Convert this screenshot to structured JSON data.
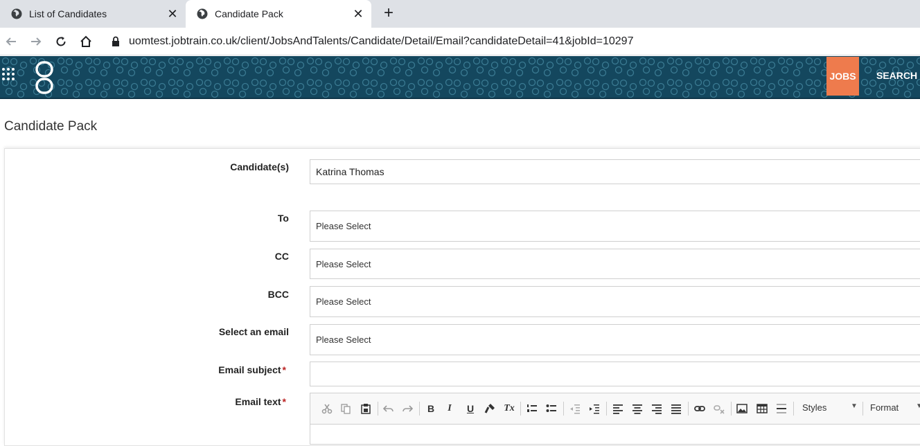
{
  "browser": {
    "tabs": [
      {
        "title": "List of Candidates"
      },
      {
        "title": "Candidate Pack"
      }
    ],
    "close_glyph": "✕",
    "new_tab_glyph": "+",
    "url": "uomtest.jobtrain.co.uk/client/JobsAndTalents/Candidate/Detail/Email?candidateDetail=41&jobId=10297"
  },
  "header": {
    "jobs_label": "JOBS",
    "search_label": "SEARCH",
    "accent_color": "#ee7b4d",
    "header_color": "#14475e"
  },
  "page": {
    "title": "Candidate Pack"
  },
  "form": {
    "candidates_label": "Candidate(s)",
    "candidates_value": "Katrina Thomas",
    "to_label": "To",
    "to_value": "Please Select",
    "cc_label": "CC",
    "cc_value": "Please Select",
    "bcc_label": "BCC",
    "bcc_value": "Please Select",
    "select_email_label": "Select an email",
    "select_email_value": "Please Select",
    "subject_label": "Email subject",
    "subject_value": "",
    "text_label": "Email text",
    "required_mark": "*"
  },
  "editor": {
    "styles_label": "Styles",
    "format_label": "Format",
    "bold": "B",
    "italic": "I",
    "underline": "U",
    "clear_format": "Tx"
  }
}
